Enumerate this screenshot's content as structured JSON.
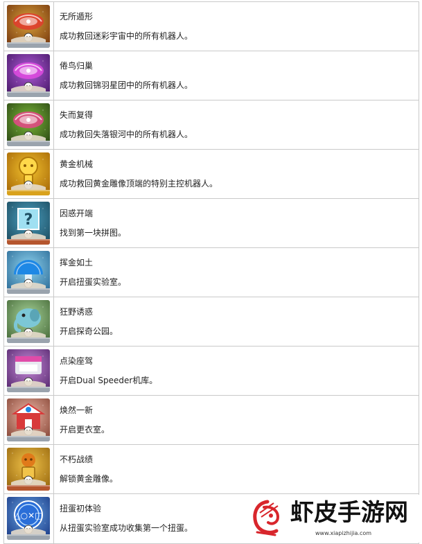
{
  "rows": [
    {
      "title": "无所遁形",
      "desc": "成功救回迷彩宇宙中的所有机器人。",
      "icon": "galaxy-trophy-icon",
      "bg": "#d9a23a",
      "bg2": "#7a3b10",
      "accent": "#e23b2e",
      "tier": "silver"
    },
    {
      "title": "倦鸟归巢",
      "desc": "成功救回锦羽星团中的所有机器人。",
      "icon": "galaxy-trophy-icon",
      "bg": "#b05ad8",
      "bg2": "#4a1b6b",
      "accent": "#e04be0",
      "tier": "silver"
    },
    {
      "title": "失而复得",
      "desc": "成功救回失落银河中的所有机器人。",
      "icon": "galaxy-trophy-icon",
      "bg": "#7dbb3a",
      "bg2": "#2d4a14",
      "accent": "#e8458a",
      "tier": "silver"
    },
    {
      "title": "黄金机械",
      "desc": "成功救回黄金雕像顶端的特别主控机器人。",
      "icon": "golden-robot-trophy-icon",
      "bg": "#f2c12e",
      "bg2": "#a86a08",
      "accent": "#ffd84a",
      "tier": "gold"
    },
    {
      "title": "因惑开端",
      "desc": "找到第一块拼图。",
      "icon": "puzzle-question-trophy-icon",
      "bg": "#4a9fc0",
      "bg2": "#1e4f63",
      "accent": "#9fe0f2",
      "tier": "bronze"
    },
    {
      "title": "挥金如土",
      "desc": "开启扭蛋实验室。",
      "icon": "gacha-lab-trophy-icon",
      "bg": "#8fd4f0",
      "bg2": "#2f6f9a",
      "accent": "#1e88e5",
      "tier": "silver"
    },
    {
      "title": "狂野诱惑",
      "desc": "开启探奇公园。",
      "icon": "elephant-trophy-icon",
      "bg": "#a8d49a",
      "bg2": "#4a6e3c",
      "accent": "#7cc7d6",
      "tier": "silver"
    },
    {
      "title": "点染座驾",
      "desc": "开启Dual Speeder机库。",
      "icon": "speeder-hangar-trophy-icon",
      "bg": "#c68ad8",
      "bg2": "#5a2b72",
      "accent": "#e8e8f0",
      "tier": "silver"
    },
    {
      "title": "焕然一新",
      "desc": "开启更衣室。",
      "icon": "changing-room-trophy-icon",
      "bg": "#f0b8a8",
      "bg2": "#8a4a3a",
      "accent": "#d83a3a",
      "tier": "silver"
    },
    {
      "title": "不朽战绩",
      "desc": "解锁黄金雕像。",
      "icon": "golden-statue-trophy-icon",
      "bg": "#f2c44a",
      "bg2": "#9a6a10",
      "accent": "#e07a1a",
      "tier": "bronze"
    },
    {
      "title": "扭蛋初体验",
      "desc": "从扭蛋实验室成功收集第一个扭蛋。",
      "icon": "playstation-capsule-trophy-icon",
      "bg": "#6aa8e8",
      "bg2": "#1e3f8a",
      "accent": "#2a6ed8",
      "tier": "silver"
    }
  ],
  "tiers": {
    "silver": "#9aa3ad",
    "gold": "#d9a21c",
    "bronze": "#b5562e"
  },
  "watermark": {
    "title": "虾皮手游网",
    "url": "www.xiapizhijia.com",
    "logo": "shrimp-logo-icon",
    "color": "#d8262c"
  }
}
